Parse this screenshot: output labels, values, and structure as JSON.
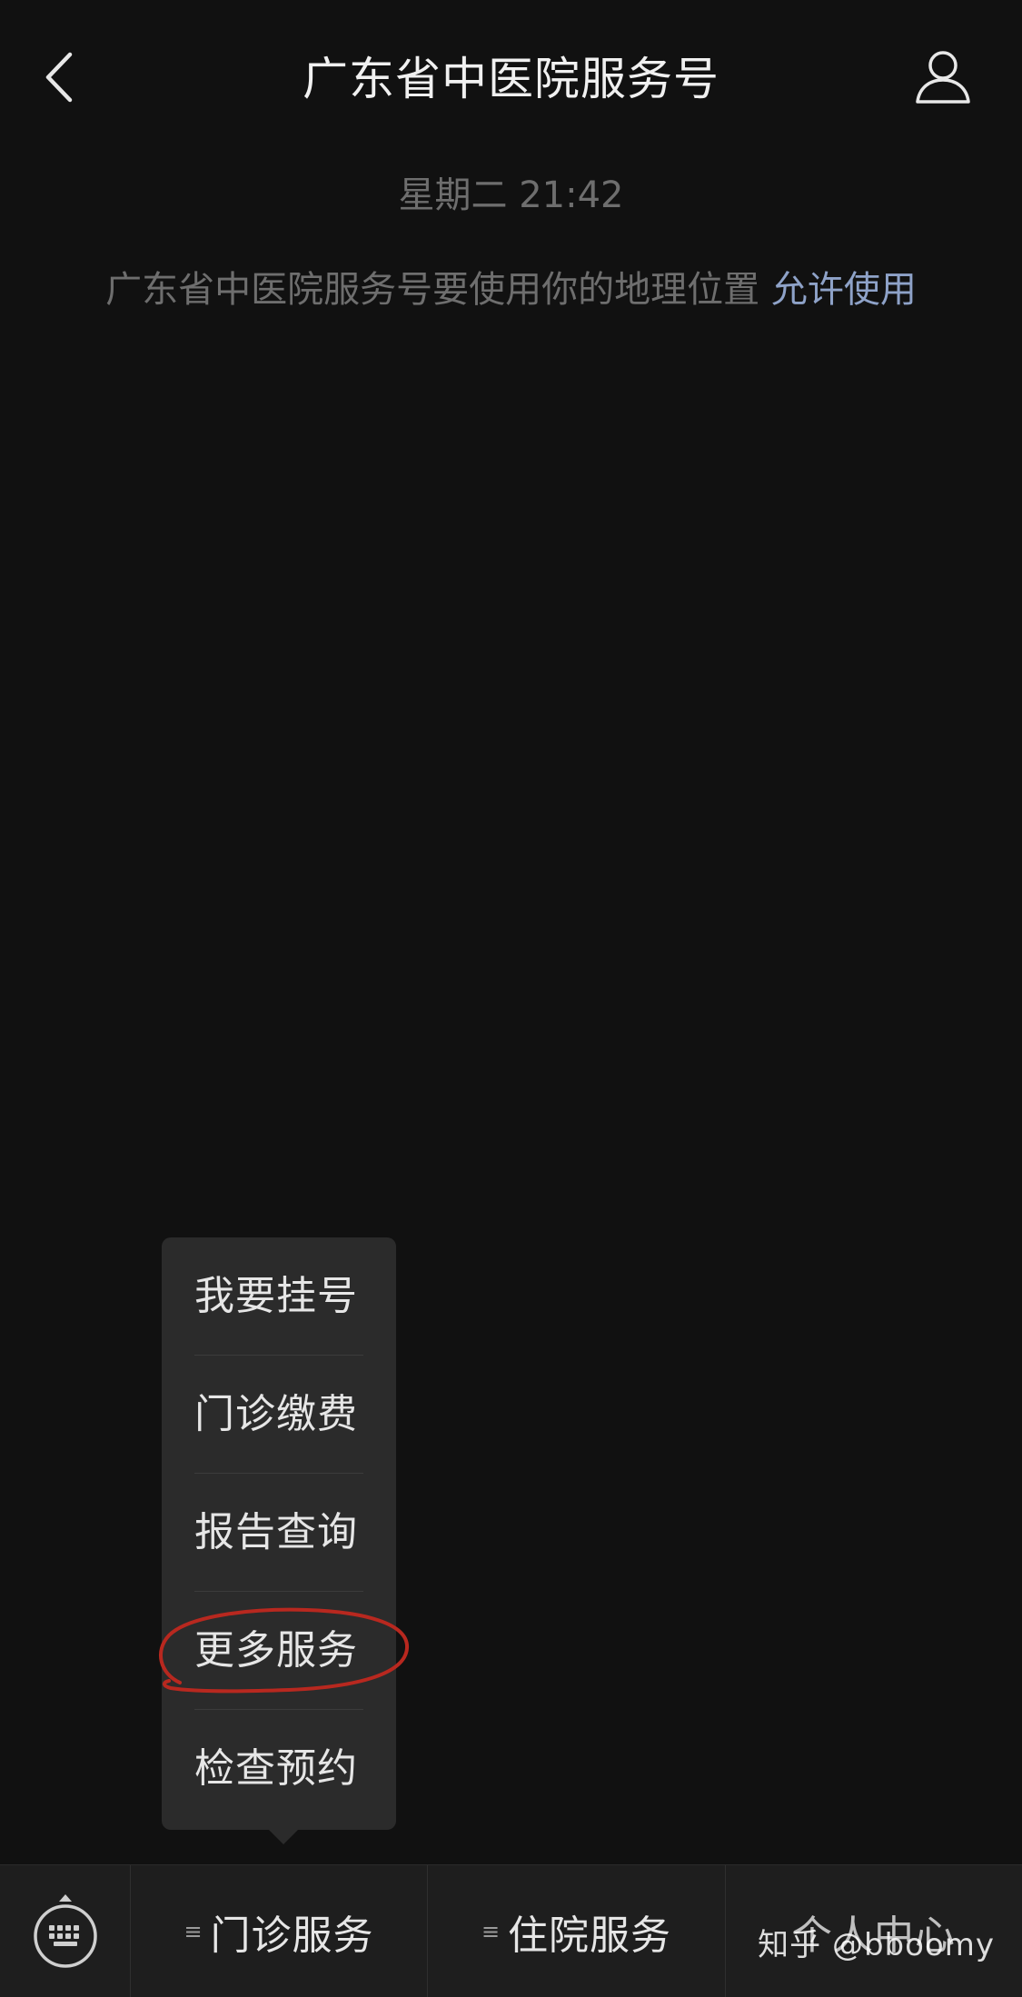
{
  "header": {
    "title": "广东省中医院服务号"
  },
  "chat": {
    "timestamp": "星期二 21:42",
    "location_notice": "广东省中医院服务号要使用你的地理位置",
    "allow_link": "允许使用"
  },
  "popup_menu": {
    "items": [
      {
        "label": "我要挂号"
      },
      {
        "label": "门诊缴费"
      },
      {
        "label": "报告查询"
      },
      {
        "label": "更多服务"
      },
      {
        "label": "检查预约"
      }
    ],
    "highlighted_item": "更多服务"
  },
  "bottom_bar": {
    "tabs": [
      {
        "label": "门诊服务"
      },
      {
        "label": "住院服务"
      },
      {
        "label": "个人中心"
      }
    ],
    "menu_glyph": "≡"
  },
  "watermark": "知乎 @bboomy",
  "colors": {
    "background": "#111111",
    "bar_background": "#1e1e1e",
    "popup_background": "#2b2b2b",
    "link": "#8ea2c8",
    "annotation": "#b8281f"
  },
  "icons": {
    "back": "chevron-left-icon",
    "profile": "person-icon",
    "keyboard": "keyboard-icon"
  }
}
